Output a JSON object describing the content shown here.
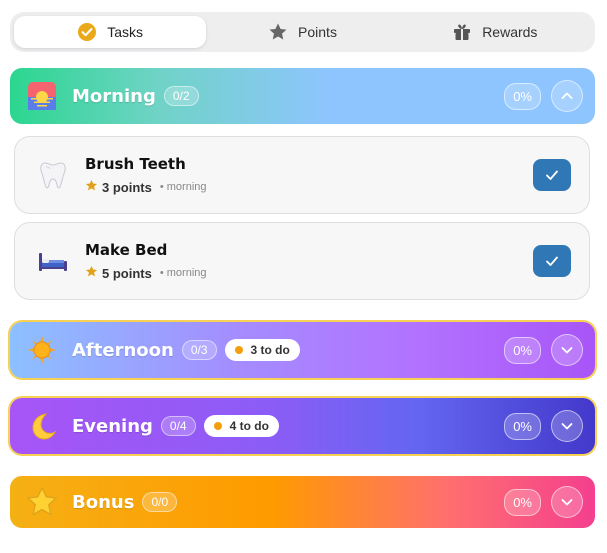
{
  "tabs": [
    {
      "label": "Tasks",
      "icon": "check-circle-icon",
      "active": true
    },
    {
      "label": "Points",
      "icon": "star-icon",
      "active": false
    },
    {
      "label": "Rewards",
      "icon": "gift-icon",
      "active": false
    }
  ],
  "sections": {
    "morning": {
      "title": "Morning",
      "count": "0/2",
      "percent": "0%",
      "icon": "sunrise-icon",
      "chevron": "chevron-up-icon"
    },
    "afternoon": {
      "title": "Afternoon",
      "count": "0/3",
      "todo": "3 to do",
      "percent": "0%",
      "icon": "sun-icon",
      "chevron": "chevron-down-icon"
    },
    "evening": {
      "title": "Evening",
      "count": "0/4",
      "todo": "4 to do",
      "percent": "0%",
      "icon": "crescent-moon-icon",
      "chevron": "chevron-down-icon"
    },
    "bonus": {
      "title": "Bonus",
      "count": "0/0",
      "percent": "0%",
      "icon": "star-icon",
      "chevron": "chevron-down-icon"
    }
  },
  "tasks": [
    {
      "name": "Brush Teeth",
      "points": "3 points",
      "period": "• morning",
      "icon": "tooth-icon"
    },
    {
      "name": "Make Bed",
      "points": "5 points",
      "period": "• morning",
      "icon": "bed-icon"
    }
  ],
  "colors": {
    "accent": "#2f78b5",
    "star": "#e0a21b",
    "highlight_outline": "#f7d154",
    "todo_dot": "#f59e0b"
  }
}
